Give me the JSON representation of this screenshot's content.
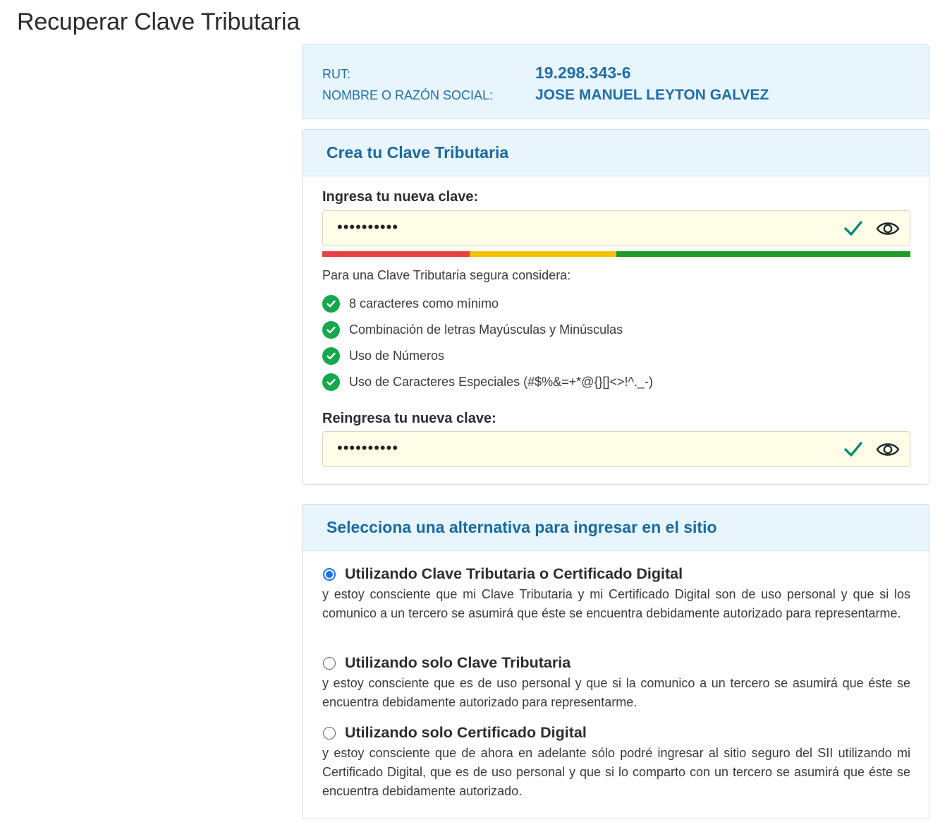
{
  "page": {
    "title": "Recuperar Clave Tributaria"
  },
  "taxpayer": {
    "rut_label": "RUT:",
    "rut_value": "19.298.343-6",
    "name_label": "NOMBRE O RAZÓN SOCIAL:",
    "name_value": "JOSE MANUEL LEYTON GALVEZ"
  },
  "create_card": {
    "title": "Crea tu Clave Tributaria",
    "new_password": {
      "label": "Ingresa tu nueva clave:",
      "masked_value": "••••••••••",
      "valid_icon": "check-icon",
      "toggle_icon": "eye-icon"
    },
    "strength_colors": [
      "#e94141",
      "#f3c300",
      "#1e9b2a",
      "#1e9b2a"
    ],
    "hint_title": "Para una Clave Tributaria segura considera:",
    "requirements": [
      {
        "text": "8 caracteres como mínimo"
      },
      {
        "text": "Combinación de letras Mayúsculas y Minúsculas"
      },
      {
        "text": "Uso de Números"
      },
      {
        "text": "Uso de Caracteres Especiales (#$%&=+*@{}[]<>!^._-)"
      }
    ],
    "repeat_password": {
      "label": "Reingresa tu nueva clave:",
      "masked_value": "••••••••••",
      "valid_icon": "check-icon",
      "toggle_icon": "eye-icon"
    }
  },
  "access_card": {
    "title": "Selecciona una alternativa para ingresar en el sitio",
    "options": [
      {
        "title": "Utilizando Clave Tributaria o Certificado Digital",
        "selected": true,
        "description": "y estoy consciente que mi Clave Tributaria y mi Certificado Digital son de uso personal y que si los comunico a un tercero se asumirá que éste se encuentra debidamente autorizado para representarme."
      },
      {
        "title": "Utilizando solo Clave Tributaria",
        "selected": false,
        "description": "y estoy consciente que es de uso personal y que si la comunico a un tercero se asumirá que éste se encuentra debidamente autorizado para representarme."
      },
      {
        "title": "Utilizando solo Certificado Digital",
        "selected": false,
        "description": "y estoy consciente que de ahora en adelante sólo podré ingresar al sitio seguro del SII utilizando mi Certificado Digital, que es de uso personal y que si lo comparto con un tercero se asumirá que éste se encuentra debidamente autorizado."
      }
    ]
  },
  "colors": {
    "accent_blue": "#1a6aa0",
    "panel_bg": "#e8f5fc",
    "input_bg": "#fdfde8",
    "valid_green": "#13a84a",
    "check_teal": "#0e8a77"
  }
}
